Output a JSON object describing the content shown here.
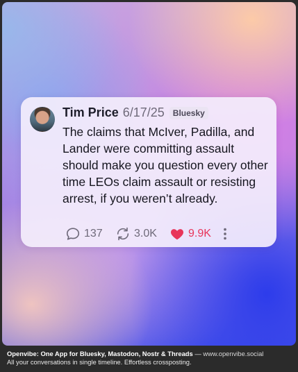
{
  "post": {
    "author": "Tim Price",
    "date": "6/17/25",
    "network": "Bluesky",
    "text": "The claims that McIver, Padilla, and Lander were committing assault should make you question every other time LEOs claim assault or resisting arrest, if you weren’t already.",
    "replies": "137",
    "reposts": "3.0K",
    "likes": "9.9K",
    "liked": true
  },
  "colors": {
    "like": "#e8355a",
    "muted": "#6f6a7a",
    "card_bg": "#f4eefc"
  },
  "icons": {
    "reply": "speech-bubble-icon",
    "repost": "repost-arrows-icon",
    "like": "heart-icon",
    "more": "vertical-ellipsis-icon"
  },
  "footer": {
    "title": "Openvibe: One App for Bluesky, Mastodon, Nostr & Threads",
    "separator": "—",
    "url": "www.openvibe.social",
    "tagline": "All your conversations in single timeline. Effortless crossposting."
  }
}
